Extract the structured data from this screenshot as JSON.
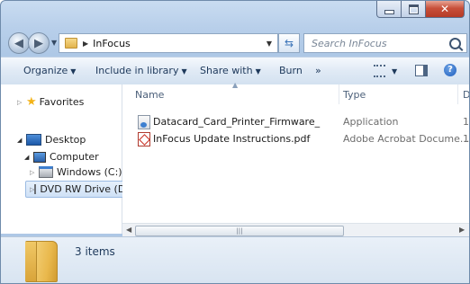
{
  "address": {
    "folder": "InFocus"
  },
  "search": {
    "placeholder": "Search InFocus"
  },
  "toolbar": {
    "organize": "Organize",
    "include_in_library": "Include in library",
    "share_with": "Share with",
    "burn": "Burn",
    "overflow": "»"
  },
  "nav": {
    "favorites": "Favorites",
    "desktop": "Desktop",
    "computer": "Computer",
    "windows_c": "Windows (C:)",
    "dvd_d": "DVD RW Drive (D:)"
  },
  "columns": {
    "name": "Name",
    "type": "Type",
    "date": "D"
  },
  "files": [
    {
      "name": "Datacard_Card_Printer_Firmware_",
      "type": "Application",
      "extra": "1",
      "icon": "application-icon"
    },
    {
      "name": "InFocus Update Instructions.pdf",
      "type": "Adobe Acrobat Docume...",
      "extra": "1",
      "icon": "pdf-icon"
    }
  ],
  "details": {
    "count": "3 items"
  },
  "colors": {
    "frame": "#b8cfea",
    "close_button": "#c8503a",
    "selection": "#cfe1f6"
  }
}
